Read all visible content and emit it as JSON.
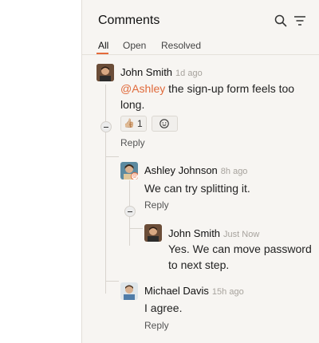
{
  "panel": {
    "title": "Comments",
    "tabs": [
      {
        "label": "All",
        "active": true
      },
      {
        "label": "Open",
        "active": false
      },
      {
        "label": "Resolved",
        "active": false
      }
    ],
    "icons": [
      "search-icon",
      "filter-icon"
    ]
  },
  "comments": [
    {
      "author": "John Smith",
      "time": "1d ago",
      "mention": "@Ashley",
      "text": " the sign-up form feels too long.",
      "reaction": {
        "emoji": "👍🏼",
        "count": "1"
      },
      "reply_label": "Reply"
    },
    {
      "author": "Ashley Johnson",
      "time": "8h ago",
      "text": "We can try splitting it.",
      "reply_label": "Reply"
    },
    {
      "author": "John Smith",
      "time": "Just Now",
      "text": "Yes. We can move password to next step."
    },
    {
      "author": "Michael Davis",
      "time": "15h ago",
      "text": "I agree.",
      "reply_label": "Reply"
    }
  ],
  "colors": {
    "accent": "#e46b3b",
    "muted_time": "#a7a39d"
  }
}
